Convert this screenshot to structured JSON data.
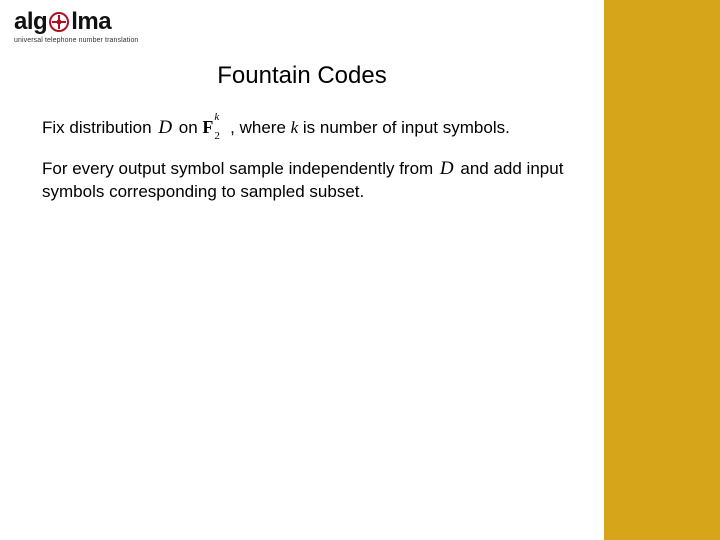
{
  "logo": {
    "part1": "alg",
    "part2": "lma",
    "tagline": "universal telephone number translation"
  },
  "title": "Fountain Codes",
  "body": {
    "p1": {
      "t1": "Fix distribution ",
      "D": "D",
      "t2": " on ",
      "F": "F",
      "Fk": "k",
      "F2": "2",
      "t3": " , where ",
      "k": "k",
      "t4": " is number of input symbols."
    },
    "p2": {
      "t1": "For every output symbol sample independently from ",
      "D": "D",
      "t2": " and add input symbols corresponding to sampled subset."
    }
  }
}
